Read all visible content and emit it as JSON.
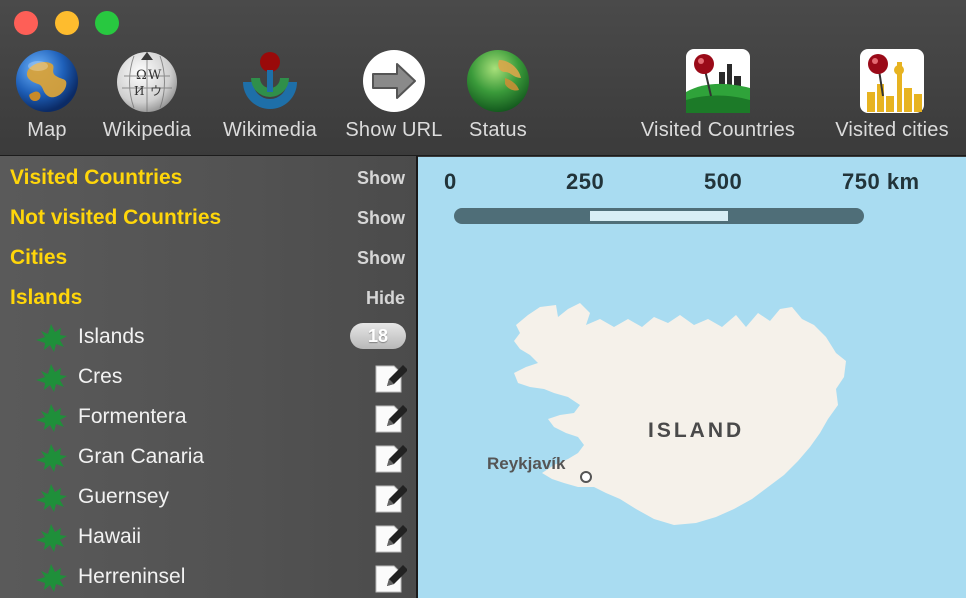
{
  "toolbar": {
    "map_label": "Map",
    "wikipedia_label": "Wikipedia",
    "wikimedia_label": "Wikimedia",
    "show_url_label": "Show URL",
    "status_label": "Status",
    "visited_countries_label": "Visited Countries",
    "visited_cities_label": "Visited cities"
  },
  "sidebar": {
    "sections": [
      {
        "title": "Visited Countries",
        "toggle": "Show"
      },
      {
        "title": "Not visited Countries",
        "toggle": "Show"
      },
      {
        "title": "Cities",
        "toggle": "Show"
      },
      {
        "title": "Islands",
        "toggle": "Hide"
      }
    ],
    "islands_group": {
      "label": "Islands",
      "count": "18"
    },
    "items": [
      {
        "name": "Cres"
      },
      {
        "name": "Formentera"
      },
      {
        "name": "Gran Canaria"
      },
      {
        "name": "Guernsey"
      },
      {
        "name": "Hawaii"
      },
      {
        "name": "Herreninsel"
      }
    ]
  },
  "map": {
    "scale": {
      "labels": [
        "0",
        "250",
        "500",
        "750 km"
      ]
    },
    "country_label": "ISLAND",
    "city_label": "Reykjavík"
  },
  "colors": {
    "section_title": "#ffd60a",
    "leaf_green": "#1f8f3a",
    "water": "#a9dcf1",
    "land": "#f5f1ea"
  }
}
